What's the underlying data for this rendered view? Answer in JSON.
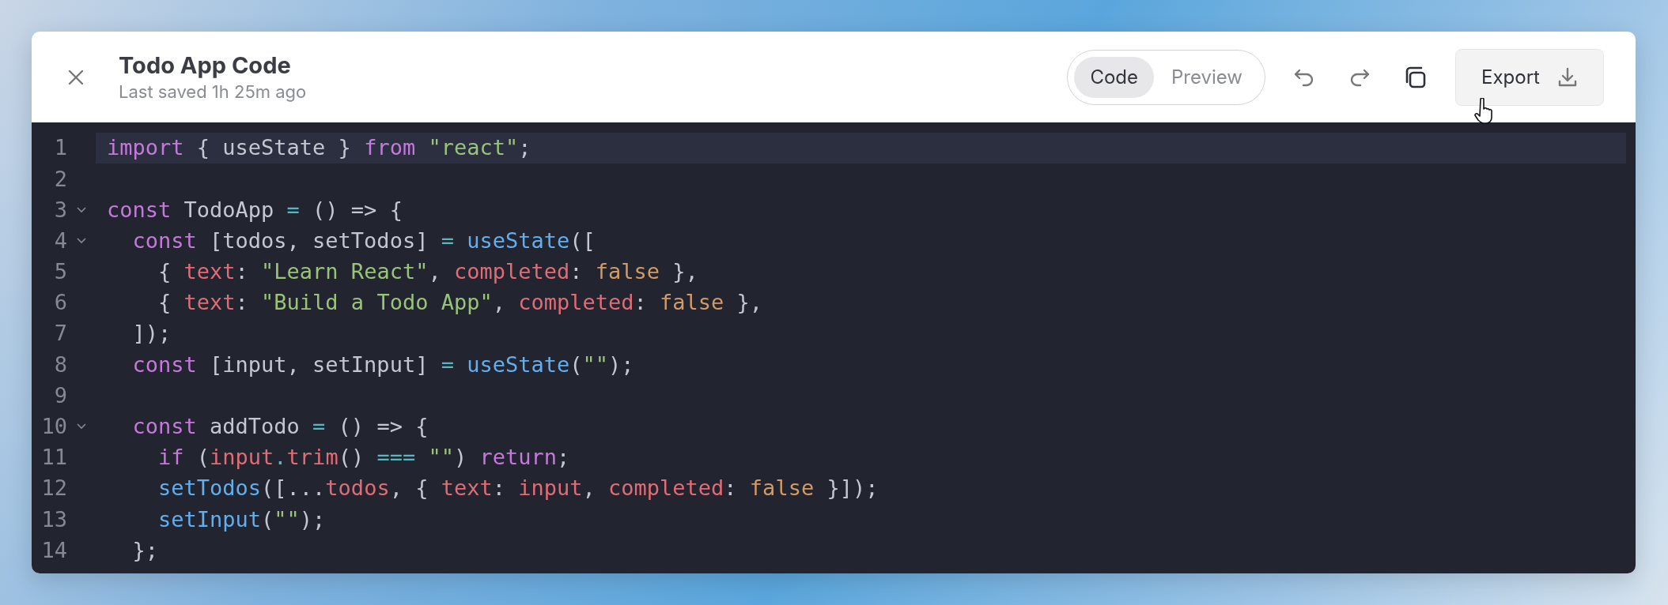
{
  "header": {
    "title": "Todo App Code",
    "subtitle": "Last saved 1h 25m ago"
  },
  "view_tabs": [
    {
      "label": "Code",
      "selected": true
    },
    {
      "label": "Preview",
      "selected": false
    }
  ],
  "export_button": {
    "label": "Export"
  },
  "editor": {
    "lines": [
      {
        "number": "1",
        "foldable": false,
        "highlighted": true,
        "tokens": [
          {
            "kind": "keyword",
            "text": "import"
          },
          {
            "kind": "plain",
            "text": " { useState } "
          },
          {
            "kind": "keyword",
            "text": "from"
          },
          {
            "kind": "string",
            "text": " \"react\""
          },
          {
            "kind": "plain",
            "text": ";"
          }
        ]
      },
      {
        "number": "2",
        "foldable": false,
        "highlighted": false
      },
      {
        "number": "3",
        "foldable": true,
        "highlighted": false,
        "tokens": [
          {
            "kind": "keyword",
            "text": "const"
          },
          {
            "kind": "plain",
            "text": " TodoApp"
          },
          {
            "kind": "operator",
            "text": " ="
          },
          {
            "kind": "plain",
            "text": " () => {"
          }
        ]
      },
      {
        "number": "4",
        "foldable": true,
        "highlighted": false,
        "tokens": [
          {
            "kind": "keyword",
            "text": "  const"
          },
          {
            "kind": "plain",
            "text": " [todos, setTodos]"
          },
          {
            "kind": "operator",
            "text": " ="
          },
          {
            "kind": "function",
            "text": " useState"
          },
          {
            "kind": "plain",
            "text": "(["
          }
        ]
      },
      {
        "number": "5",
        "foldable": false,
        "highlighted": false,
        "tokens": [
          {
            "kind": "plain",
            "text": "    {"
          },
          {
            "kind": "property",
            "text": " text"
          },
          {
            "kind": "plain",
            "text": ":"
          },
          {
            "kind": "string",
            "text": " \"Learn React\""
          },
          {
            "kind": "plain",
            "text": ","
          },
          {
            "kind": "property",
            "text": " completed"
          },
          {
            "kind": "plain",
            "text": ":"
          },
          {
            "kind": "boolean",
            "text": " false"
          },
          {
            "kind": "plain",
            "text": " },"
          }
        ]
      },
      {
        "number": "6",
        "foldable": false,
        "highlighted": false,
        "tokens": [
          {
            "kind": "plain",
            "text": "    {"
          },
          {
            "kind": "property",
            "text": " text"
          },
          {
            "kind": "plain",
            "text": ":"
          },
          {
            "kind": "string",
            "text": " \"Build a Todo App\""
          },
          {
            "kind": "plain",
            "text": ","
          },
          {
            "kind": "property",
            "text": " completed"
          },
          {
            "kind": "plain",
            "text": ":"
          },
          {
            "kind": "boolean",
            "text": " false"
          },
          {
            "kind": "plain",
            "text": " },"
          }
        ]
      },
      {
        "number": "7",
        "foldable": false,
        "highlighted": false,
        "tokens": [
          {
            "kind": "plain",
            "text": "  ]);"
          }
        ]
      },
      {
        "number": "8",
        "foldable": false,
        "highlighted": false,
        "tokens": [
          {
            "kind": "keyword",
            "text": "  const"
          },
          {
            "kind": "plain",
            "text": " [input, setInput]"
          },
          {
            "kind": "operator",
            "text": " ="
          },
          {
            "kind": "function",
            "text": " useState"
          },
          {
            "kind": "plain",
            "text": "("
          },
          {
            "kind": "string",
            "text": "\"\""
          },
          {
            "kind": "plain",
            "text": ");"
          }
        ]
      },
      {
        "number": "9",
        "foldable": false,
        "highlighted": false
      },
      {
        "number": "10",
        "foldable": true,
        "highlighted": false,
        "tokens": [
          {
            "kind": "keyword",
            "text": "  const"
          },
          {
            "kind": "plain",
            "text": " addTodo"
          },
          {
            "kind": "operator",
            "text": " ="
          },
          {
            "kind": "plain",
            "text": " () => {"
          }
        ]
      },
      {
        "number": "11",
        "foldable": false,
        "highlighted": false,
        "tokens": [
          {
            "kind": "keyword",
            "text": "    if"
          },
          {
            "kind": "plain",
            "text": " ("
          },
          {
            "kind": "property",
            "text": "input"
          },
          {
            "kind": "operator",
            "text": "."
          },
          {
            "kind": "property",
            "text": "trim"
          },
          {
            "kind": "plain",
            "text": "()"
          },
          {
            "kind": "operator",
            "text": " ==="
          },
          {
            "kind": "string",
            "text": " \"\""
          },
          {
            "kind": "plain",
            "text": ")"
          },
          {
            "kind": "keyword",
            "text": " return"
          },
          {
            "kind": "plain",
            "text": ";"
          }
        ]
      },
      {
        "number": "12",
        "foldable": false,
        "highlighted": false,
        "tokens": [
          {
            "kind": "function",
            "text": "    setTodos"
          },
          {
            "kind": "plain",
            "text": "([..."
          },
          {
            "kind": "property",
            "text": "todos"
          },
          {
            "kind": "plain",
            "text": ", {"
          },
          {
            "kind": "property",
            "text": " text"
          },
          {
            "kind": "plain",
            "text": ":"
          },
          {
            "kind": "property",
            "text": " input"
          },
          {
            "kind": "plain",
            "text": ","
          },
          {
            "kind": "property",
            "text": " completed"
          },
          {
            "kind": "plain",
            "text": ":"
          },
          {
            "kind": "boolean",
            "text": " false"
          },
          {
            "kind": "plain",
            "text": " }]);"
          }
        ]
      },
      {
        "number": "13",
        "foldable": false,
        "highlighted": false,
        "tokens": [
          {
            "kind": "function",
            "text": "    setInput"
          },
          {
            "kind": "plain",
            "text": "("
          },
          {
            "kind": "string",
            "text": "\"\""
          },
          {
            "kind": "plain",
            "text": ");"
          }
        ]
      },
      {
        "number": "14",
        "foldable": false,
        "highlighted": false,
        "tokens": [
          {
            "kind": "plain",
            "text": "  };"
          }
        ]
      }
    ]
  }
}
